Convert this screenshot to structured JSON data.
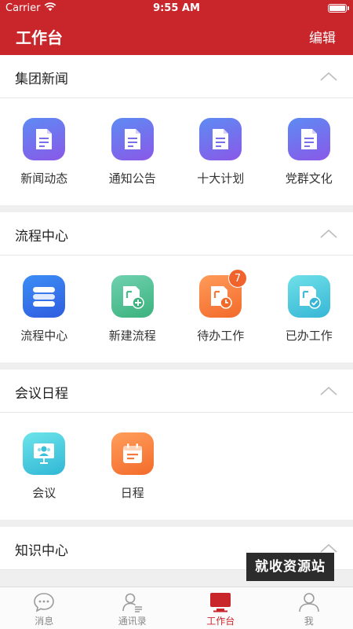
{
  "status": {
    "carrier": "Carrier",
    "time": "9:55 AM"
  },
  "nav": {
    "title": "工作台",
    "edit": "编辑"
  },
  "sections": [
    {
      "title": "集团新闻",
      "items": [
        {
          "label": "新闻动态",
          "icon": "document-icon"
        },
        {
          "label": "通知公告",
          "icon": "document-icon"
        },
        {
          "label": "十大计划",
          "icon": "document-icon"
        },
        {
          "label": "党群文化",
          "icon": "document-icon"
        }
      ]
    },
    {
      "title": "流程中心",
      "items": [
        {
          "label": "流程中心",
          "icon": "process-list-icon"
        },
        {
          "label": "新建流程",
          "icon": "new-process-icon"
        },
        {
          "label": "待办工作",
          "icon": "pending-work-icon",
          "badge": "7"
        },
        {
          "label": "已办工作",
          "icon": "done-work-icon"
        }
      ]
    },
    {
      "title": "会议日程",
      "items": [
        {
          "label": "会议",
          "icon": "meeting-icon"
        },
        {
          "label": "日程",
          "icon": "schedule-icon"
        }
      ]
    },
    {
      "title": "知识中心"
    }
  ],
  "watermark": "就收资源站",
  "tabs": [
    {
      "label": "消息",
      "icon": "chat-bubble-icon"
    },
    {
      "label": "通讯录",
      "icon": "contacts-icon"
    },
    {
      "label": "工作台",
      "icon": "monitor-icon",
      "active": true
    },
    {
      "label": "我",
      "icon": "user-icon"
    }
  ],
  "colors": {
    "brand": "#c9262c",
    "badge": "#f1632c"
  }
}
